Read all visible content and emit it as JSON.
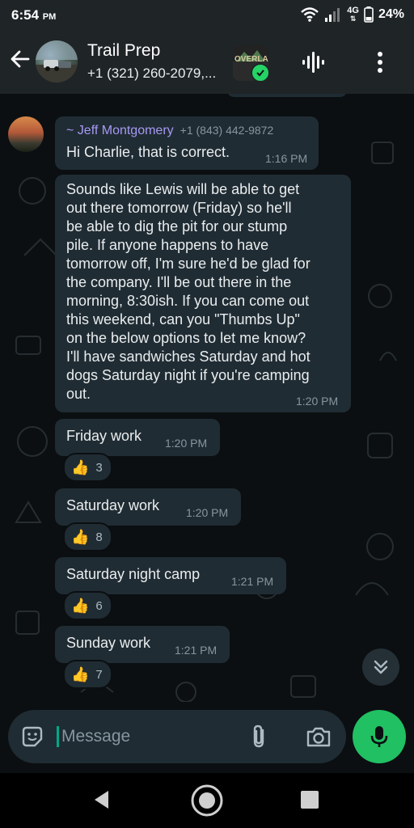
{
  "status_bar": {
    "time": "6:54",
    "ampm": "PM",
    "network": "4G",
    "battery": "24%"
  },
  "header": {
    "title": "Trail Prep",
    "subtitle": "+1 (321) 260-2079,...",
    "community_badge_text": "OVERLAND"
  },
  "messages": [
    {
      "sender": "~ Jeff Montgomery",
      "phone": "+1 (843) 442-9872",
      "text": "Hi Charlie, that is correct.",
      "time": "1:16 PM"
    },
    {
      "lines": [
        "Sounds like Lewis will be able to get",
        "out there tomorrow (Friday) so he'll",
        "be able to dig the pit for our stump",
        "pile. If anyone happens to have",
        "tomorrow off, I'm sure he'd be glad for",
        "the company. I'll be out there in the",
        "morning, 8:30ish. If you can come out",
        "this weekend, can you \"Thumbs Up\"",
        "on the below options to let me know?",
        "I'll have sandwiches Saturday and hot",
        "dogs Saturday night if you're camping",
        "out."
      ],
      "time": "1:20 PM"
    }
  ],
  "polls": [
    {
      "text": "Friday work",
      "time": "1:20 PM",
      "reaction": "👍",
      "count": "3"
    },
    {
      "text": "Saturday work",
      "time": "1:20 PM",
      "reaction": "👍",
      "count": "8"
    },
    {
      "text": "Saturday night camp",
      "time": "1:21 PM",
      "reaction": "👍",
      "count": "6"
    },
    {
      "text": "Sunday work",
      "time": "1:21 PM",
      "reaction": "👍",
      "count": "7"
    }
  ],
  "compose": {
    "placeholder": "Message"
  },
  "colors": {
    "bubble": "#202c33",
    "sender_name": "#a799f5",
    "accent_green": "#21c063",
    "background": "#0b0f11"
  },
  "icons": {
    "back": "arrow-left-icon",
    "voice_call": "audio-waveform-icon",
    "menu": "more-vertical-icon",
    "scroll_down": "double-chevron-down-icon",
    "sticker": "sticker-icon",
    "attach": "paperclip-icon",
    "camera": "camera-icon",
    "mic": "mic-icon"
  }
}
